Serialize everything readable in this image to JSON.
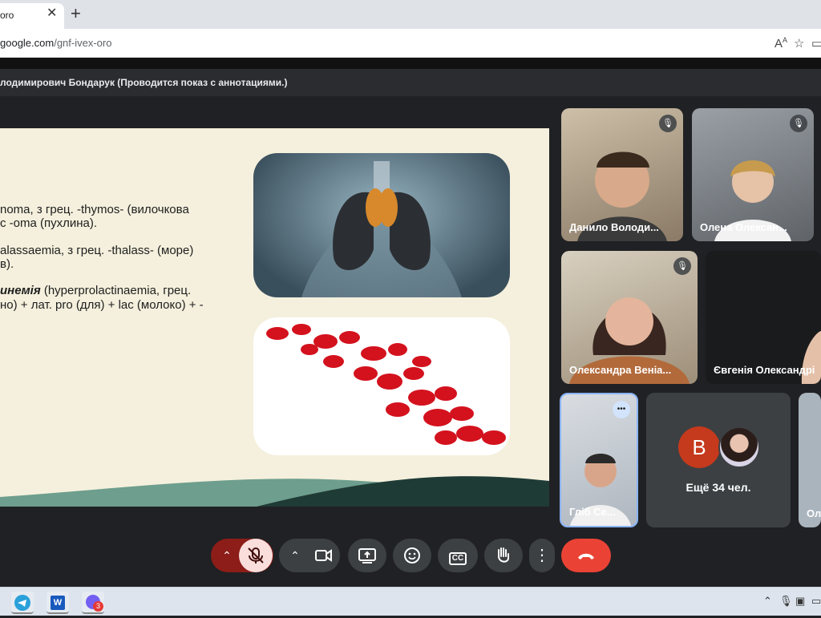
{
  "browser": {
    "tab_title": "oro",
    "tab_close": "✕",
    "new_tab": "+",
    "url_host": "google.com",
    "url_path": "/gnf-ivex-oro",
    "read_aloud": "A",
    "favorite": "☆"
  },
  "meet": {
    "presenter_banner": "лодимирович Бондарук (Проводится показ с аннотациями.)",
    "slide": {
      "line1": "noma, з грец. -thymos- (вилочкова",
      "line2": "с -oma (пухлина).",
      "line3": "alassaemia, з грец. -thalass- (море)",
      "line4": "в).",
      "line5_bold": "инемія",
      "line5_rest": " (hyperprolactinaemia, грец.",
      "line6": "но) + лат. pro (для) + lac (молоко) + -"
    },
    "participants": [
      {
        "name": "Данило Володи...",
        "muted": true
      },
      {
        "name": "Олена Олексан...",
        "muted": true
      },
      {
        "name": "Олександра Веніа...",
        "muted": true
      },
      {
        "name": "Євгенія Олександрі",
        "muted": false
      },
      {
        "name": "Гліб Се...",
        "muted": false
      },
      {
        "name": "Ол",
        "muted": false
      }
    ],
    "more_tile": {
      "avatar_letter": "B",
      "label": "Ещё 34 чел."
    },
    "more_options": "•••",
    "controls": {
      "chevron": "⌃",
      "mic": "mic-off",
      "camera": "camera",
      "present": "present",
      "emoji": "emoji",
      "captions": "CC",
      "hand": "raise-hand",
      "more": "⋮",
      "leave": "end-call"
    }
  },
  "taskbar": {
    "viber_badge": "3",
    "word_letter": "W"
  },
  "colors": {
    "leave": "#ea4335",
    "mic_off_bg": "#f9dedc",
    "mic_group": "#8c1d18",
    "avatar_b": "#c5391c"
  }
}
